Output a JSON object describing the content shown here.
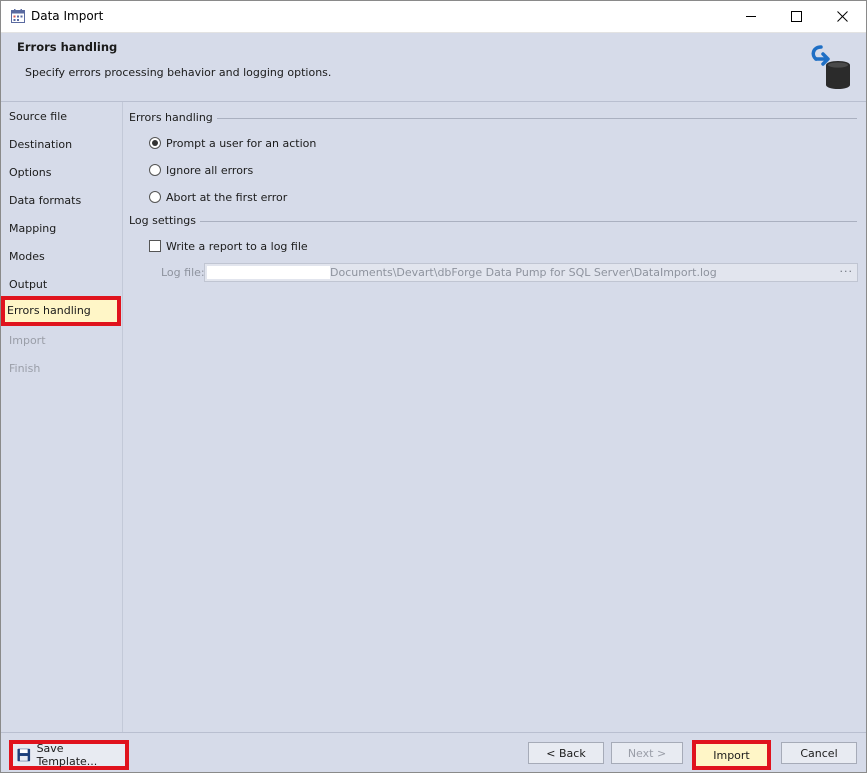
{
  "window": {
    "title": "Data Import"
  },
  "header": {
    "title": "Errors handling",
    "description": "Specify errors processing behavior and logging options."
  },
  "sidebar": {
    "items": [
      {
        "label": "Source file",
        "state": "normal"
      },
      {
        "label": "Destination",
        "state": "normal"
      },
      {
        "label": "Options",
        "state": "normal"
      },
      {
        "label": "Data formats",
        "state": "normal"
      },
      {
        "label": "Mapping",
        "state": "normal"
      },
      {
        "label": "Modes",
        "state": "normal"
      },
      {
        "label": "Output",
        "state": "normal"
      },
      {
        "label": "Errors handling",
        "state": "active"
      },
      {
        "label": "Import",
        "state": "disabled"
      },
      {
        "label": "Finish",
        "state": "disabled"
      }
    ]
  },
  "errors_handling": {
    "group_label": "Errors handling",
    "options": [
      {
        "label": "Prompt a user for an action",
        "checked": true
      },
      {
        "label": "Ignore all errors",
        "checked": false
      },
      {
        "label": "Abort at the first error",
        "checked": false
      }
    ]
  },
  "log_settings": {
    "group_label": "Log settings",
    "write_report_label": "Write a report to a log file",
    "write_report_checked": false,
    "log_file_label": "Log file:",
    "log_file_value": "Documents\\Devart\\dbForge Data Pump for SQL Server\\DataImport.log",
    "browse_label": "···"
  },
  "footer": {
    "save_template_label": "Save Template...",
    "back_label": "< Back",
    "next_label": "Next >",
    "import_label": "Import",
    "cancel_label": "Cancel"
  },
  "colors": {
    "highlight_border": "#e0131d",
    "active_background": "#fff6c7",
    "panel_background": "#d6dbe9"
  }
}
